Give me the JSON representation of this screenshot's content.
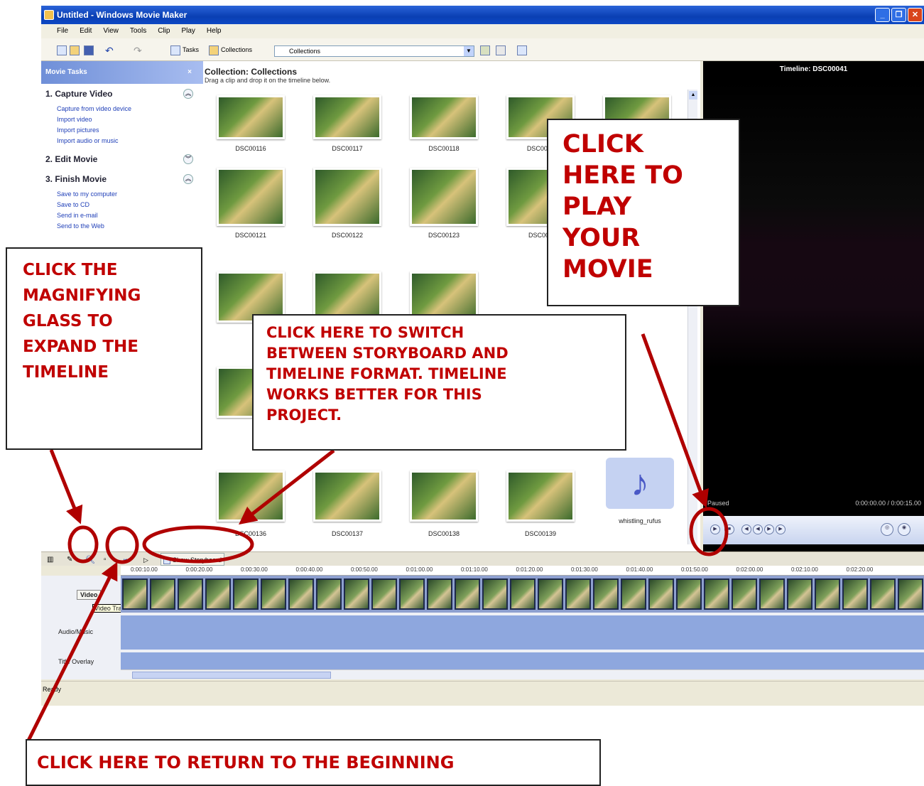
{
  "window": {
    "title": "Untitled - Windows Movie Maker",
    "buttons": [
      "_",
      "❐",
      "✕"
    ]
  },
  "menubar": [
    "File",
    "Edit",
    "View",
    "Tools",
    "Clip",
    "Play",
    "Help"
  ],
  "toolbar": {
    "tasks_label": "Tasks",
    "collections_label": "Collections",
    "collection_select": "Collections"
  },
  "tasks_pane": {
    "header": "Movie Tasks",
    "close": "×",
    "sections": [
      {
        "title": "1. Capture Video",
        "links": [
          "Capture from video device",
          "Import video",
          "Import pictures",
          "Import audio or music"
        ]
      },
      {
        "title": "2. Edit Movie",
        "links": []
      },
      {
        "title": "3. Finish Movie",
        "links": [
          "Save to my computer",
          "Save to CD",
          "Send in e-mail",
          "Send to the Web"
        ]
      }
    ]
  },
  "collection": {
    "title": "Collection: Collections",
    "hint": "Drag a clip and drop it on the timeline below.",
    "clips": [
      "DSC00116",
      "DSC00117",
      "DSC00118",
      "DSC0011",
      "DSC00121",
      "DSC00122",
      "DSC00123",
      "DSC001",
      "DSC00136",
      "DSC00137",
      "DSC00138",
      "DSC00139"
    ],
    "music_item": "whistling_rufus"
  },
  "preview": {
    "title": "Timeline: DSC00041",
    "status": "Paused",
    "time": "0:00:00.00 / 0:00:15.00"
  },
  "timeline": {
    "show_storyboard": "Show Storyboard",
    "ruler": [
      "0:00:10.00",
      "0:00:20.00",
      "0:00:30.00",
      "0:00:40.00",
      "0:00:50.00",
      "0:01:00.00",
      "0:01:10.00",
      "0:01:20.00",
      "0:01:30.00",
      "0:01:40.00",
      "0:01:50.00",
      "0:02:00.00",
      "0:02:10.00",
      "0:02:20.00"
    ],
    "tracks": {
      "video": "Video",
      "tooltip": "Video Track",
      "audio": "Audio/Music",
      "title": "Title Overlay"
    }
  },
  "statusbar": "Ready",
  "callouts": {
    "play": [
      "CLICK",
      "HERE TO",
      "PLAY",
      "YOUR",
      "MOVIE"
    ],
    "magnify": [
      "CLICK THE",
      "MAGNIFYING",
      "GLASS TO",
      "EXPAND THE",
      "TIMELINE"
    ],
    "switch": [
      "CLICK HERE TO SWITCH",
      "BETWEEN STORYBOARD AND",
      "TIMELINE FORMAT.  TIMELINE",
      "WORKS BETTER FOR THIS",
      "PROJECT."
    ],
    "begin": "CLICK HERE TO RETURN TO THE BEGINNING"
  },
  "colors": {
    "callout_text": "#c00000",
    "annotation": "#b00000",
    "titlebar": "#0a3fb3"
  }
}
